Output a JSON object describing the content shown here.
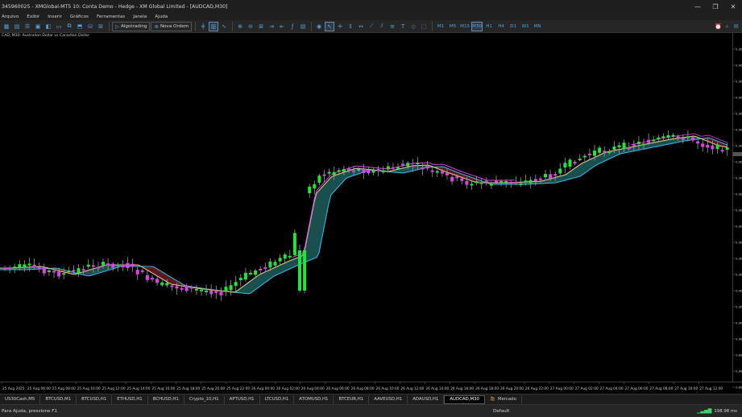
{
  "window": {
    "title": "345960025 - XMGlobal-MT5 10: Conta Demo - Hedge - XM Global Limited - [AUDCAD,M30]",
    "minimize": "—",
    "maximize": "❐",
    "close": "✕"
  },
  "menu": [
    "Arquivo",
    "Exibir",
    "Inserir",
    "Gráficos",
    "Ferramentas",
    "Janela",
    "Ajuda"
  ],
  "toolbar": {
    "algo_label": "Algotrading",
    "order_label": "Nova Ordem",
    "timeframes": [
      "M1",
      "M5",
      "M15",
      "M30",
      "H1",
      "H4",
      "D1",
      "W1",
      "MN"
    ],
    "active_timeframe": "M30"
  },
  "chart": {
    "label": "CAD, M30: Australian Dollar vs Canadian Dollar",
    "colors": {
      "bull": "#22e33a",
      "bear": "#e040e8",
      "wick": "#9a9a9a",
      "ma_fast": "#e3c48a",
      "ma_slow": "#3ab0e0",
      "ma_upper": "#e040e8",
      "cloud_bull": "#1d5e5a",
      "cloud_bear": "#6a1f24"
    }
  },
  "chart_data": {
    "type": "candlestick",
    "time_labels": [
      "25 Aug 2025",
      "25 Aug 06:00",
      "25 Aug 08:00",
      "25 Aug 10:00",
      "25 Aug 12:00",
      "25 Aug 14:00",
      "25 Aug 16:00",
      "25 Aug 18:00",
      "25 Aug 20:00",
      "25 Aug 22:00",
      "26 Aug 00:00",
      "26 Aug 02:00",
      "26 Aug 04:00",
      "26 Aug 06:00",
      "26 Aug 08:00",
      "26 Aug 10:00",
      "26 Aug 12:00",
      "26 Aug 14:00",
      "26 Aug 16:00",
      "26 Aug 18:00",
      "26 Aug 20:00",
      "26 Aug 22:00",
      "27 Aug 00:00",
      "27 Aug 02:00",
      "27 Aug 04:00",
      "27 Aug 06:00",
      "27 Aug 08:00",
      "27 Aug 10:00",
      "27 Aug 12:00"
    ],
    "price_labels": [
      "0.90",
      "0.90",
      "0.90",
      "0.90",
      "0.90",
      "0.90",
      "0.90",
      "0.90",
      "0.90",
      "0.90",
      "0.90",
      "0.90",
      "0.90",
      "0.90",
      "0.90",
      "0.90",
      "0.90",
      "0.90",
      "0.89",
      "0.89",
      "0.89",
      "0.89"
    ]
  },
  "tabs": [
    {
      "label": "US30Cash,M5"
    },
    {
      "label": "BTCUSD,M1"
    },
    {
      "label": "BTCUSD,H1"
    },
    {
      "label": "ETHUSD,H1"
    },
    {
      "label": "BCHUSD,H1"
    },
    {
      "label": "Crypto_10,H1"
    },
    {
      "label": "APTUSD,H1"
    },
    {
      "label": "LTCUSD,H1"
    },
    {
      "label": "ATOMUSD,H1"
    },
    {
      "label": "BTCEUR,H1"
    },
    {
      "label": "AAVEUSD,H1"
    },
    {
      "label": "ADAUSD,H1"
    },
    {
      "label": "AUDCAD,M30"
    },
    {
      "label": "Mercado"
    }
  ],
  "status": {
    "help": "Para Ajuda, pressione F1",
    "profile": "Default",
    "network": "198.98 ms"
  }
}
